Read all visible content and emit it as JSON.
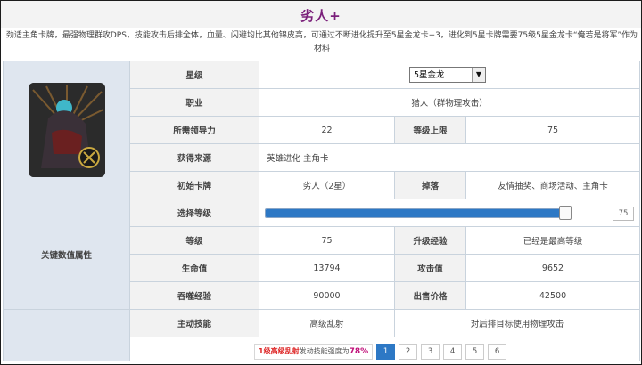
{
  "title": "劣人+",
  "description": "劲适主角卡牌，最强物理群攻DPS，技能攻击后排全体，血量、闪避均比其他锦皮高，可通过不断进化提升至5星金龙卡+3，进化到5星卡牌需要75级5星金龙卡“俺若是将军”作为材料",
  "rows": {
    "star": {
      "label": "星级",
      "value": "5星金龙"
    },
    "job": {
      "label": "职业",
      "value": "猎人（群物理攻击）"
    },
    "leadership": {
      "label": "所需领导力",
      "value": "22"
    },
    "level_cap": {
      "label": "等级上限",
      "value": "75"
    },
    "source": {
      "label": "获得来源",
      "value": "英雄进化  主角卡"
    },
    "initial_card": {
      "label": "初始卡牌",
      "value": "劣人（2星）"
    },
    "drop": {
      "label": "掉落",
      "value": "友情抽奖、商场活动、主角卡"
    }
  },
  "stats_section_label": "关键数值属性",
  "level_select": {
    "label": "选择等级",
    "value": "75",
    "fraction": 1.0
  },
  "stats": {
    "level": {
      "label": "等级",
      "value": "75"
    },
    "upgrade_exp": {
      "label": "升级经验",
      "value": "已经是最高等级"
    },
    "hp": {
      "label": "生命值",
      "value": "13794"
    },
    "attack": {
      "label": "攻击值",
      "value": "9652"
    },
    "devour_exp": {
      "label": "吞噬经验",
      "value": "90000"
    },
    "sell_price": {
      "label": "出售价格",
      "value": "42500"
    }
  },
  "skill": {
    "label": "主动技能",
    "name": "高级乱射",
    "effect": "对后排目标使用物理攻击"
  },
  "pager": {
    "note_prefix": "1级",
    "note_skill": "高级乱射",
    "note_mid": "发动技能强度为",
    "note_percent": "78%",
    "pages": [
      "1",
      "2",
      "3",
      "4",
      "5",
      "6"
    ],
    "active": "1"
  },
  "colors": {
    "accent": "#2d78c5",
    "title": "#7a1f7a"
  }
}
